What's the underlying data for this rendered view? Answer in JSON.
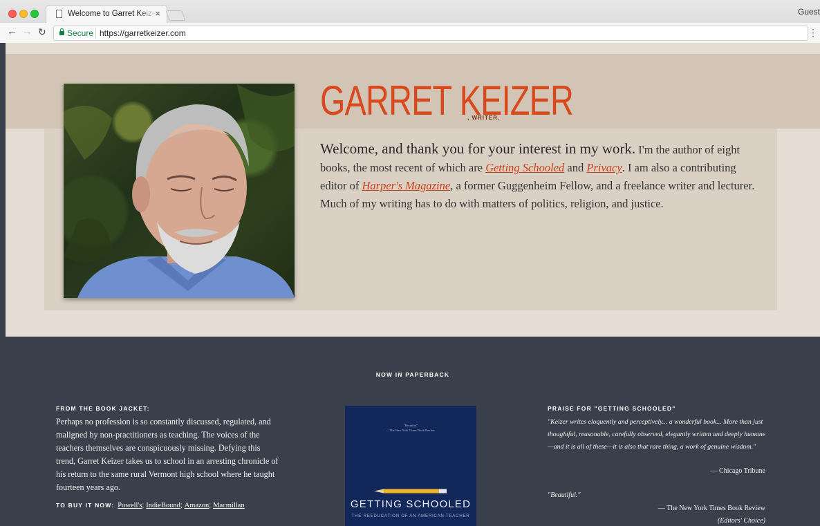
{
  "browser": {
    "tab_title": "Welcome to Garret Keizer's official website",
    "tab_close": "×",
    "profile": "Guest",
    "secure_label": "Secure",
    "url": "https://garretkeizer.com",
    "icons": [
      "back-arrow-icon",
      "forward-arrow-icon",
      "reload-icon",
      "lock-icon",
      "page-icon",
      "close-icon",
      "menu-icon"
    ]
  },
  "hero": {
    "name": "GARRET KEIZER",
    "tagline": ", WRITER.",
    "intro": {
      "lead": "Welcome, and thank you for your interest in my work.",
      "part1": " I'm the author of eight books, the most recent of which are ",
      "link1": "Getting Schooled",
      "part2": " and ",
      "link2": "Privacy",
      "part3": ". I am also a contributing editor of ",
      "link3": "Harper's Magazine",
      "part4": ", a former Guggenheim Fellow, and a freelance writer and lecturer. Much of my writing has to do with matters of politics, religion, and justice."
    }
  },
  "paperback": {
    "heading": "NOW IN PAPERBACK",
    "jacket": {
      "heading": "FROM THE BOOK JACKET:",
      "body": "Perhaps no profession is so constantly discussed, regulated, and maligned by non-practitioners as teaching. The voices of the teachers themselves are conspicuously missing. Defying this trend, Garret Keizer takes us to school in an arresting chronicle of his return to the same rural Vermont high school where he taught fourteen years ago."
    },
    "buy": {
      "label": "TO BUY IT NOW:",
      "links": [
        "Powell's",
        "IndieBound",
        "Amazon",
        "Macmillan"
      ],
      "sep": ";"
    },
    "book": {
      "quote": "\"Beautiful\"",
      "quote_source": "—The New York Times Book Review",
      "title": "GETTING SCHOOLED",
      "subtitle": "THE REEDUCATION OF AN AMERICAN TEACHER"
    },
    "praise": {
      "heading": "PRAISE FOR \"GETTING SCHOOLED\"",
      "quote1": "\"Keizer writes eloquently and perceptively... a wonderful book... More than just thoughtful, reasonable, carefully observed, elegantly written and deeply humane—and it is all of these—it is also that rare thing, a work of genuine wisdom.\"",
      "attr1": "— Chicago Tribune",
      "quote2": "\"Beautiful.\"",
      "attr2": "— The New York Times Book Review",
      "attr3": "(Editors' Choice)"
    }
  },
  "colors": {
    "accent": "#d8491d",
    "dark_section": "#3a404b",
    "hero_bg": "#e5ddd3",
    "book_cover": "#13285a"
  }
}
